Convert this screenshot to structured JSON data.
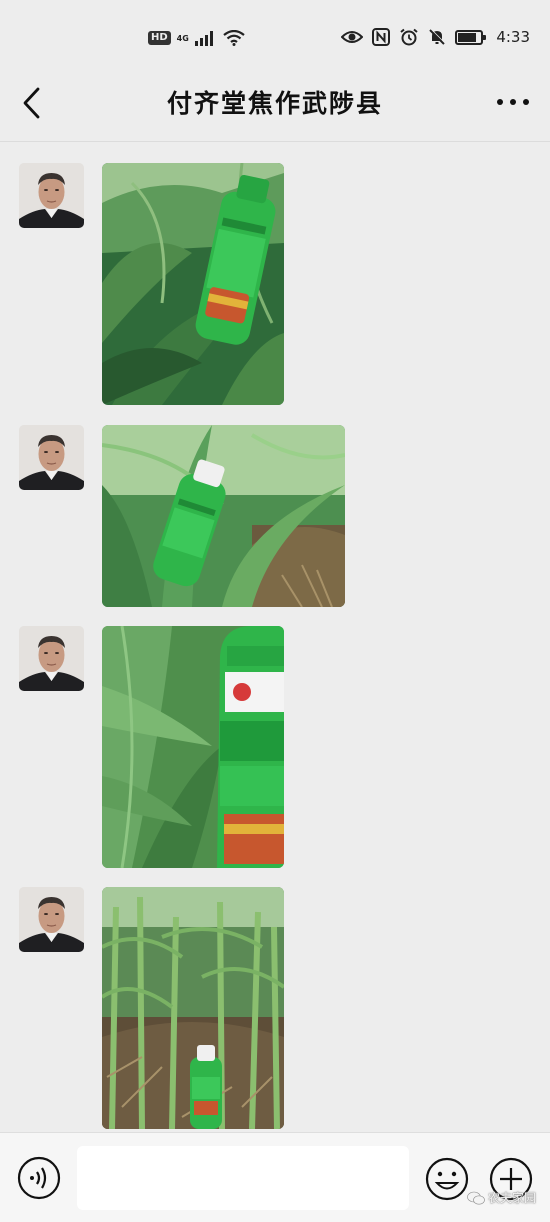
{
  "status_bar": {
    "hd": "HD",
    "network": "4G",
    "time": "4:33",
    "battery_level": 0.8,
    "icons": [
      "signal-icon",
      "wifi-icon",
      "eye-icon",
      "nfc-icon",
      "alarm-icon",
      "mute-icon",
      "battery-icon"
    ]
  },
  "header": {
    "title": "付齐堂焦作武陟县",
    "back_icon": "chevron-left-icon",
    "more_icon": "more-dots-icon"
  },
  "messages": [
    {
      "type": "image",
      "sender": "contact",
      "subject": "green fertilizer bottle held among corn leaves",
      "orientation": "portrait"
    },
    {
      "type": "image",
      "sender": "contact",
      "subject": "green fertilizer bottle on corn stalk",
      "orientation": "landscape"
    },
    {
      "type": "image",
      "sender": "contact",
      "subject": "close-up of green fertilizer bottle label",
      "orientation": "portrait"
    },
    {
      "type": "image",
      "sender": "contact",
      "subject": "green fertilizer bottle on ground in corn field",
      "orientation": "portrait"
    }
  ],
  "input_bar": {
    "placeholder": "",
    "voice_icon": "voice-icon",
    "emoji_icon": "emoji-icon",
    "plus_icon": "plus-icon"
  },
  "watermark": {
    "text": "农夫家园",
    "icon": "wechat-icon"
  },
  "colors": {
    "background": "#ededed",
    "bottle_green": "#2fb54a",
    "leaf_green": "#3e8a45"
  }
}
